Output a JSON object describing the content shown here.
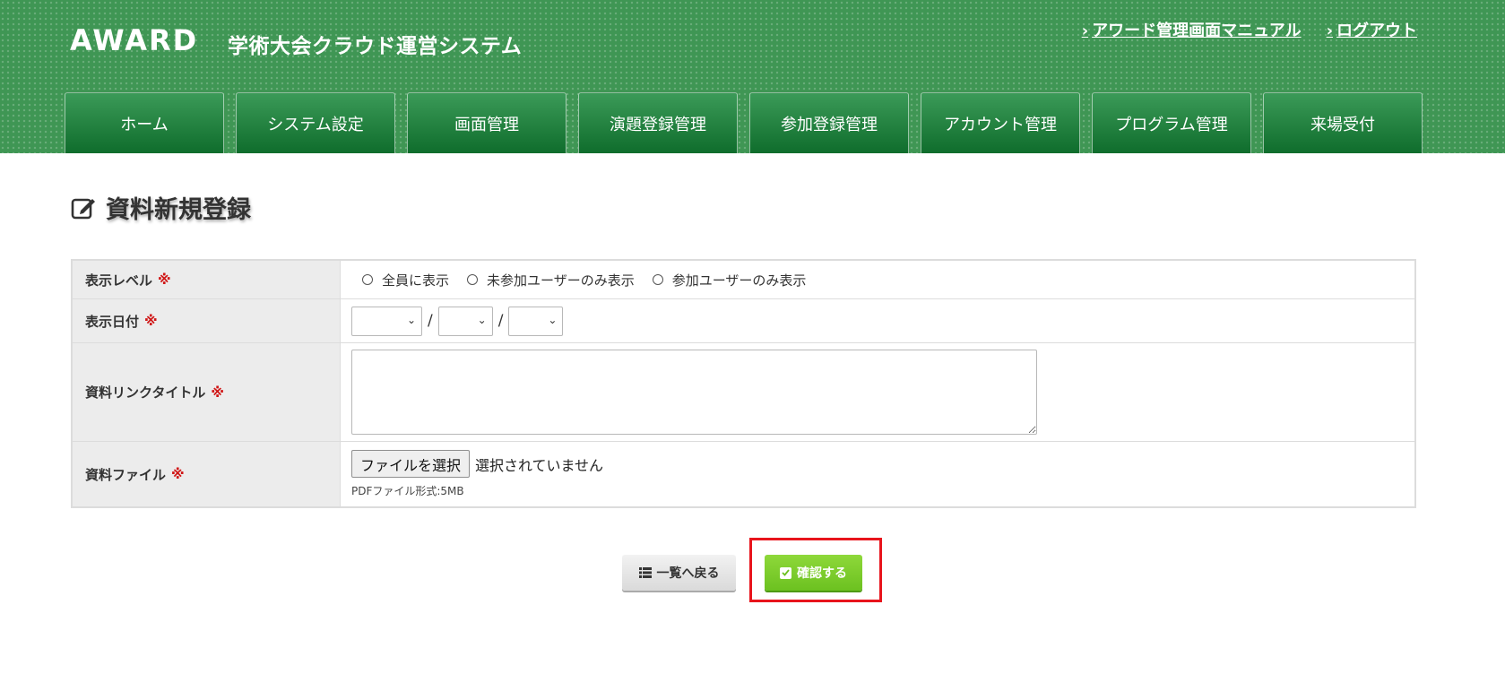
{
  "header": {
    "logo": "AWARD",
    "site_title": "学術大会クラウド運営システム",
    "links": [
      {
        "label": "アワード管理画面マニュアル"
      },
      {
        "label": "ログアウト"
      }
    ],
    "link_chevron": "›",
    "colors": {
      "header_bg": "#3f9654",
      "tab_bg": "#0f6d2c"
    }
  },
  "nav": {
    "tabs": [
      {
        "label": "ホーム"
      },
      {
        "label": "システム設定"
      },
      {
        "label": "画面管理"
      },
      {
        "label": "演題登録管理"
      },
      {
        "label": "参加登録管理"
      },
      {
        "label": "アカウント管理"
      },
      {
        "label": "プログラム管理"
      },
      {
        "label": "来場受付"
      }
    ]
  },
  "page": {
    "title": "資料新規登録",
    "title_icon": "edit-icon"
  },
  "form": {
    "required_mark": "※",
    "display_level": {
      "label": "表示レベル",
      "options": [
        {
          "label": "全員に表示",
          "selected": false
        },
        {
          "label": "未参加ユーザーのみ表示",
          "selected": false
        },
        {
          "label": "参加ユーザーのみ表示",
          "selected": false
        }
      ]
    },
    "display_date": {
      "label": "表示日付",
      "separator": "/",
      "year_value": "",
      "month_value": "",
      "day_value": ""
    },
    "link_title": {
      "label": "資料リンクタイトル",
      "value": ""
    },
    "file": {
      "label": "資料ファイル",
      "button_label": "ファイルを選択",
      "status": "選択されていません",
      "note": "PDFファイル形式:5MB"
    }
  },
  "actions": {
    "back_label": "一覧へ戻る",
    "confirm_label": "確認する",
    "colors": {
      "confirm_bg": "#7ccc2c",
      "highlight_border": "#e8141c"
    }
  }
}
